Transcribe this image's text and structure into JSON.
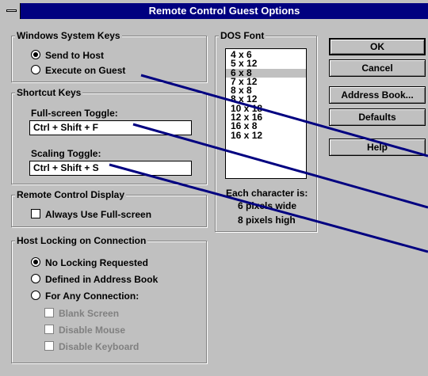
{
  "window": {
    "title": "Remote Control Guest Options"
  },
  "windows_system_keys": {
    "label": "Windows System Keys",
    "options": [
      {
        "label": "Send to Host",
        "selected": true
      },
      {
        "label": "Execute on Guest",
        "selected": false
      }
    ]
  },
  "shortcut_keys": {
    "label": "Shortcut Keys",
    "fullscreen_label": "Full-screen Toggle:",
    "fullscreen_value": "Ctrl + Shift + F",
    "scaling_label": "Scaling Toggle:",
    "scaling_value": "Ctrl + Shift + S"
  },
  "remote_display": {
    "label": "Remote Control Display",
    "always_fullscreen": "Always Use Full-screen"
  },
  "host_locking": {
    "label": "Host Locking on Connection",
    "options": [
      {
        "label": "No Locking Requested",
        "selected": true
      },
      {
        "label": "Defined in Address Book",
        "selected": false
      },
      {
        "label": "For Any Connection:",
        "selected": false
      }
    ],
    "sub_options": [
      "Blank Screen",
      "Disable Mouse",
      "Disable Keyboard"
    ]
  },
  "dos_font": {
    "label": "DOS Font",
    "items": [
      "4 x  6",
      "5 x 12",
      "6 x  8",
      "7 x 12",
      "8 x  8",
      "8 x 12",
      "10 x 18",
      "12 x 16",
      "16 x  8",
      "16 x 12"
    ],
    "selected": "6 x  8",
    "info_title": "Each character is:",
    "info_width": "6  pixels wide",
    "info_height": "8  pixels high"
  },
  "buttons": {
    "ok": "OK",
    "cancel": "Cancel",
    "address_book": "Address Book...",
    "defaults": "Defaults",
    "help": "Help"
  }
}
